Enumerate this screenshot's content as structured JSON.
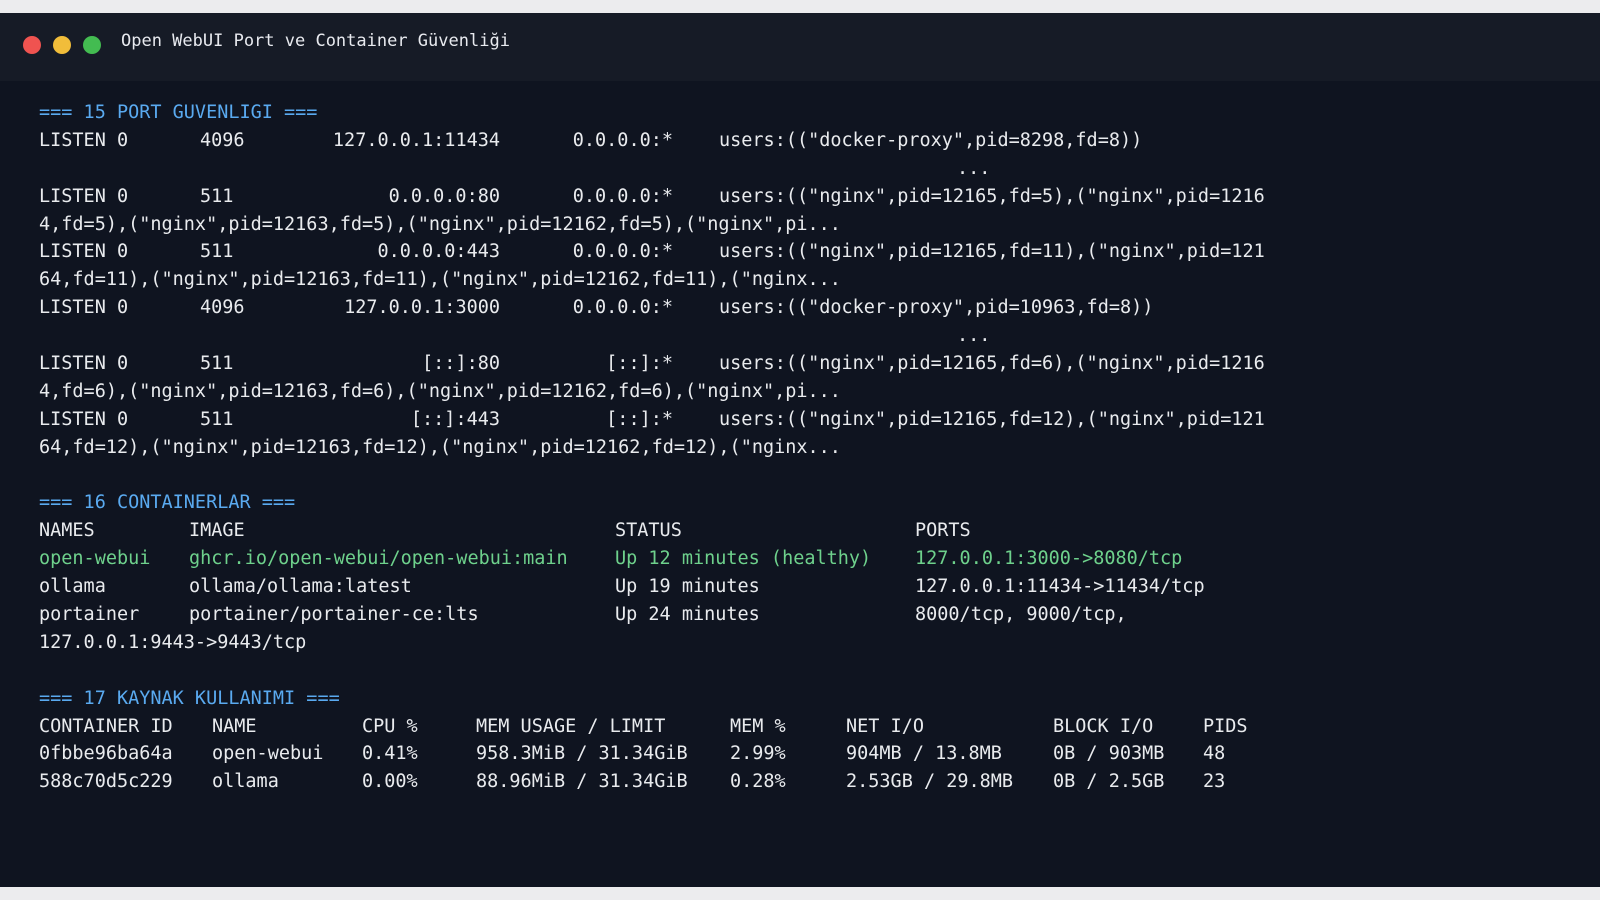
{
  "window": {
    "title": "Open WebUI Port ve Container Güvenliği",
    "colors": {
      "background": "#0f1420",
      "titlebar": "#161b26",
      "text": "#e9ebee",
      "heading": "#5aaaf0",
      "highlight": "#6ed18c",
      "close": "#ef5350",
      "minimize": "#f1bd3a",
      "maximize": "#43bc51"
    }
  },
  "ports": {
    "heading": "=== 15 PORT GUVENLIGI ===",
    "rows": [
      {
        "state": "LISTEN 0",
        "qsize": "4096",
        "local": "127.0.0.1:11434",
        "peer": "0.0.0.0:*",
        "process": "users:((\"docker-proxy\",pid=8298,fd=8))",
        "cont": "...",
        "cont_center": true
      },
      {
        "state": "LISTEN 0",
        "qsize": "511",
        "local": "0.0.0.0:80",
        "peer": "0.0.0.0:*",
        "process": "users:((\"nginx\",pid=12165,fd=5),(\"nginx\",pid=1216",
        "cont": "4,fd=5),(\"nginx\",pid=12163,fd=5),(\"nginx\",pid=12162,fd=5),(\"nginx\",pi..."
      },
      {
        "state": "LISTEN 0",
        "qsize": "511",
        "local": "0.0.0.0:443",
        "peer": "0.0.0.0:*",
        "process": "users:((\"nginx\",pid=12165,fd=11),(\"nginx\",pid=121",
        "cont": "64,fd=11),(\"nginx\",pid=12163,fd=11),(\"nginx\",pid=12162,fd=11),(\"nginx..."
      },
      {
        "state": "LISTEN 0",
        "qsize": "4096",
        "local": "127.0.0.1:3000",
        "peer": "0.0.0.0:*",
        "process": "users:((\"docker-proxy\",pid=10963,fd=8))",
        "cont": "...",
        "cont_center": true
      },
      {
        "state": "LISTEN 0",
        "qsize": "511",
        "local": "[::]:80",
        "peer": "[::]:*",
        "process": "users:((\"nginx\",pid=12165,fd=6),(\"nginx\",pid=1216",
        "cont": "4,fd=6),(\"nginx\",pid=12163,fd=6),(\"nginx\",pid=12162,fd=6),(\"nginx\",pi..."
      },
      {
        "state": "LISTEN 0",
        "qsize": "511",
        "local": "[::]:443",
        "peer": "[::]:*",
        "process": "users:((\"nginx\",pid=12165,fd=12),(\"nginx\",pid=121",
        "cont": "64,fd=12),(\"nginx\",pid=12163,fd=12),(\"nginx\",pid=12162,fd=12),(\"nginx..."
      }
    ]
  },
  "containers": {
    "heading": "=== 16 CONTAINERLAR ===",
    "columns": [
      "NAMES",
      "IMAGE",
      "STATUS",
      "PORTS"
    ],
    "rows": [
      [
        "open-webui",
        "ghcr.io/open-webui/open-webui:main",
        "Up 12 minutes (healthy)",
        "127.0.0.1:3000->8080/tcp"
      ],
      [
        "ollama",
        "ollama/ollama:latest",
        "Up 19 minutes",
        "127.0.0.1:11434->11434/tcp"
      ],
      [
        "portainer",
        "portainer/portainer-ce:lts",
        "Up 24 minutes",
        "8000/tcp, 9000/tcp,"
      ]
    ],
    "wrap": "127.0.0.1:9443->9443/tcp"
  },
  "resources": {
    "heading": "=== 17 KAYNAK KULLANIMI ===",
    "columns": [
      "CONTAINER ID",
      "NAME",
      "CPU %",
      "MEM USAGE / LIMIT",
      "MEM %",
      "NET I/O",
      "BLOCK I/O",
      "PIDS"
    ],
    "rows": [
      [
        "0fbbe96ba64a",
        "open-webui",
        "0.41%",
        "958.3MiB / 31.34GiB",
        "2.99%",
        "904MB / 13.8MB",
        "0B / 903MB",
        "48"
      ],
      [
        "588c70d5c229",
        "ollama",
        "0.00%",
        "88.96MiB / 31.34GiB",
        "0.28%",
        "2.53GB / 29.8MB",
        "0B / 2.5GB",
        "23"
      ]
    ]
  }
}
